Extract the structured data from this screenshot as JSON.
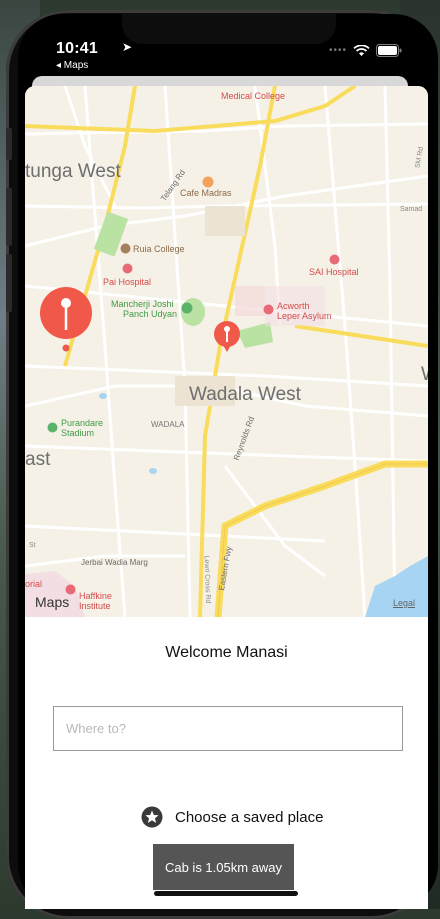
{
  "status_bar": {
    "time": "10:41",
    "back_app": "◂ Maps"
  },
  "map": {
    "area_labels": {
      "matunga_west": "tunga West",
      "wadala_west": "Wadala West",
      "wadala": "WADALA",
      "east": "ast",
      "w_edge": "W"
    },
    "pois": {
      "medical_college": "Medical College",
      "cafe_madras": "Cafe Madras",
      "ruia_college": "Ruia College",
      "pai_hospital": "Pai Hospital",
      "sai_hospital": "SAI Hospital",
      "mancherji_line1": "Mancherji Joshi",
      "mancherji_line2": "Panch Udyan",
      "acworth_line1": "Acworth",
      "acworth_line2": "Leper Asylum",
      "purandare_line1": "Purandare",
      "purandare_line2": "Stadium",
      "haffkine_line1": "Haffkine",
      "haffkine_line2": "Institute",
      "orial": "orial"
    },
    "roads": {
      "telang_rd": "Telang Rd",
      "reynolds_rd": "Reynolds Rd",
      "jerbai_wadia": "Jerbai Wadia Marg",
      "eastern_fwy": "Eastern Fwy",
      "lewri_cross": "Lewri Cross Rd",
      "sm_rd": "SM Rd",
      "samad": "Samad",
      "st": "St"
    },
    "maps_logo": "Maps",
    "legal": "Legal"
  },
  "panel": {
    "welcome": "Welcome Manasi",
    "where_placeholder": "Where to?",
    "saved_place_label": "Choose a saved place",
    "cab_status": "Cab is 1.05km away"
  },
  "colors": {
    "pin_red": "#f0584a",
    "road_yellow": "#f9dc5c",
    "park_green": "#b9e2a3",
    "water_blue": "#a6d4f2",
    "button_gray": "#555555"
  }
}
